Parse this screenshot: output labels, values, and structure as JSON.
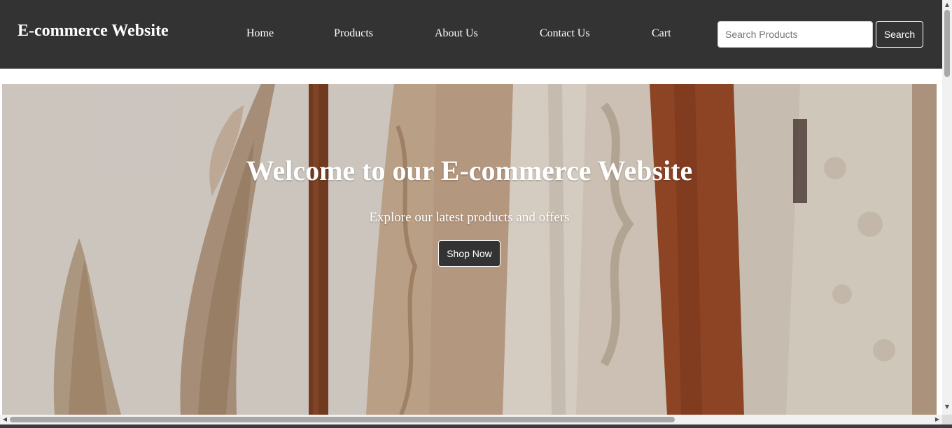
{
  "header": {
    "brand": "E-commerce Website",
    "nav": [
      {
        "label": "Home"
      },
      {
        "label": "Products"
      },
      {
        "label": "About Us"
      },
      {
        "label": "Contact Us"
      },
      {
        "label": "Cart"
      }
    ],
    "search": {
      "placeholder": "Search Products",
      "value": "",
      "button_label": "Search"
    }
  },
  "hero": {
    "title": "Welcome to our E-commerce Website",
    "subtitle": "Explore our latest products and offers",
    "cta_label": "Shop Now",
    "image_description_icon": "clothing-rack-photo"
  },
  "colors": {
    "header_bg": "#333333",
    "header_text": "#ffffff",
    "button_bg": "#333333"
  },
  "icons": {
    "scroll_up": "▲",
    "scroll_down": "▼",
    "scroll_left": "◀",
    "scroll_right": "▶"
  }
}
